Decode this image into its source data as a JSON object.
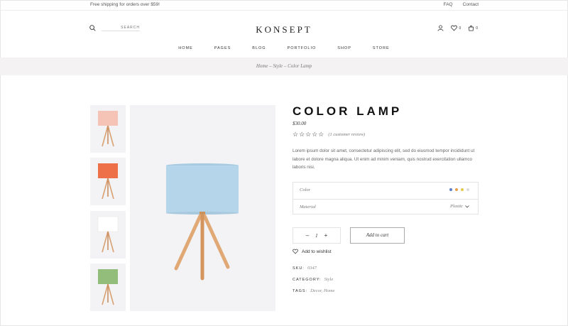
{
  "topbar": {
    "shipping": "Free shipping for orders over $59!",
    "links": [
      "FAQ",
      "Contact"
    ]
  },
  "header": {
    "search_label": "SEARCH",
    "logo": "KONSEPT",
    "wishlist_count": "0",
    "cart_count": "0"
  },
  "nav": [
    "HOME",
    "PAGES",
    "BLOG",
    "PORTFOLIO",
    "SHOP",
    "STORE"
  ],
  "breadcrumb": "Home – Style – Color Lamp",
  "gallery": {
    "thumbnails": [
      {
        "name": "pink-lamp",
        "shade": "#f6c4b6"
      },
      {
        "name": "coral-lamp",
        "shade": "#ee7048"
      },
      {
        "name": "white-lamp",
        "shade": "#eeeeee"
      },
      {
        "name": "green-lamp",
        "shade": "#92bd7b"
      }
    ],
    "main_shade": "#b5d6ea"
  },
  "product": {
    "title": "COLOR LAMP",
    "price": "$30.00",
    "rating_stars": 0,
    "review_text": "(1 customer review)",
    "description": "Lorem ipsum dolor sit amet, consectetur adipiscing elit, sed do eiusmod tempor incididunt ut labore et dolore magna aliqua. Ut enim ad minim veniam, quis nostrud exercitation ullamco laboris nisi.",
    "color_label": "Color",
    "swatches": [
      "#5b7fc2",
      "#e3a04d",
      "#e8c94a",
      "#dcdcdc"
    ],
    "material_label": "Material",
    "material_value": "Plastic",
    "quantity": "1",
    "add_to_cart": "Add to cart",
    "wishlist": "Add to wishlist",
    "sku_label": "SKU:",
    "sku": "0347",
    "category_label": "CATEGORY:",
    "category": "Style",
    "tags_label": "TAGS:",
    "tags": "Decor, Home"
  },
  "colors": {
    "band": "#f4f2f2",
    "panel": "#f3f3f5",
    "wood": "#e0a874"
  }
}
